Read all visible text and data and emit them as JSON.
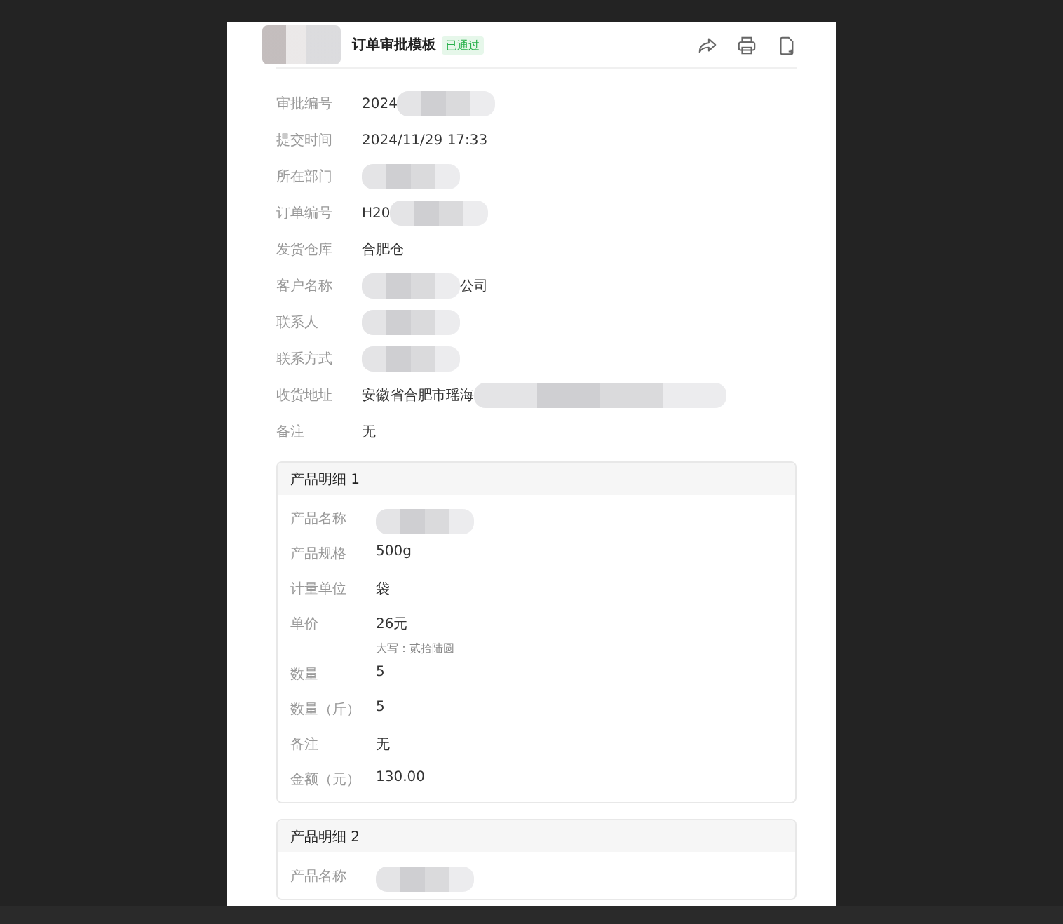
{
  "header": {
    "title": "订单审批模板",
    "status_badge": "已通过",
    "title_redacted": true
  },
  "fields": [
    {
      "label": "审批编号",
      "value": "2024",
      "redacted": true
    },
    {
      "label": "提交时间",
      "value": "2024/11/29 17:33",
      "redacted": false
    },
    {
      "label": "所在部门",
      "redacted": true
    },
    {
      "label": "订单编号",
      "value": "H20",
      "redacted": true
    },
    {
      "label": "发货仓库",
      "value": "合肥仓",
      "redacted": false
    },
    {
      "label": "客户名称",
      "value": "公司",
      "redacted": true,
      "redacted_before": true
    },
    {
      "label": "联系人",
      "redacted": true
    },
    {
      "label": "联系方式",
      "redacted": true
    },
    {
      "label": "收货地址",
      "value": "安徽省合肥市瑶海",
      "redacted": true
    },
    {
      "label": "备注",
      "value": "无",
      "redacted": false
    }
  ],
  "products": [
    {
      "title": "产品明细 1",
      "fields": [
        {
          "label": "产品名称",
          "redacted": true
        },
        {
          "label": "产品规格",
          "value": "500g",
          "redacted": false
        },
        {
          "label": "计量单位",
          "value": "袋",
          "redacted": false
        },
        {
          "label": "单价",
          "value": "26元",
          "redacted": false,
          "note": "大写：贰拾陆圆"
        },
        {
          "label": "数量",
          "value": "5",
          "redacted": false
        },
        {
          "label": "数量（斤）",
          "value": "5",
          "redacted": false
        },
        {
          "label": "备注",
          "value": "无",
          "redacted": false
        },
        {
          "label": "金额（元）",
          "value": "130.00",
          "redacted": false
        }
      ]
    },
    {
      "title": "产品明细 2",
      "fields": [
        {
          "label": "产品名称",
          "redacted": true
        }
      ]
    }
  ]
}
